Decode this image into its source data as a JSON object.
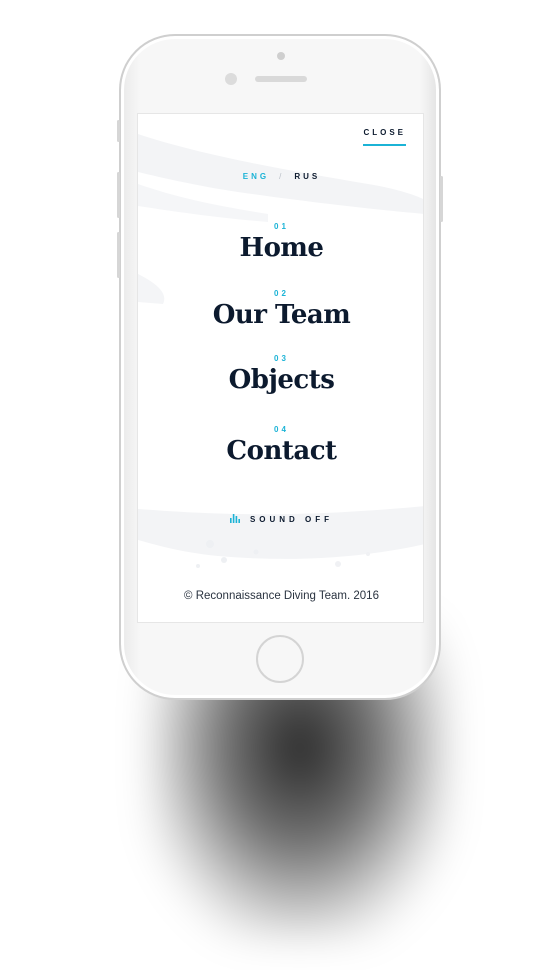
{
  "nav": {
    "close_label": "CLOSE"
  },
  "language": {
    "active": "ENG",
    "separator": "/",
    "other": "RUS"
  },
  "menu": {
    "items": [
      {
        "number": "01",
        "label": "Home"
      },
      {
        "number": "02",
        "label": "Our Team"
      },
      {
        "number": "03",
        "label": "Objects"
      },
      {
        "number": "04",
        "label": "Contact"
      }
    ]
  },
  "sound": {
    "label": "SOUND OFF",
    "icon": "equalizer-icon"
  },
  "footer": {
    "copyright": "© Reconnaissance Diving Team. 2016"
  },
  "colors": {
    "accent": "#1bb3d6",
    "text": "#0c1a2e",
    "phone_body": "#f7f7f7"
  }
}
